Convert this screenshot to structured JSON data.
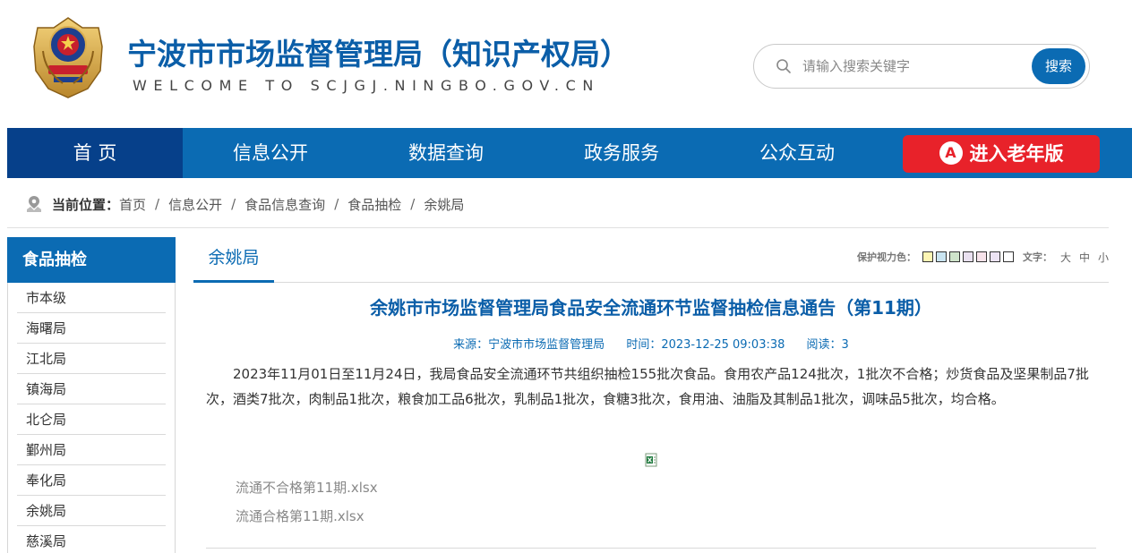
{
  "header": {
    "title": "宁波市市场监督管理局（知识产权局）",
    "subtitle": "WELCOME TO SCJGJ.NINGBO.GOV.CN",
    "search_placeholder": "请输入搜索关键字",
    "search_button": "搜索"
  },
  "nav": {
    "items": [
      "首 页",
      "信息公开",
      "数据查询",
      "政务服务",
      "公众互动"
    ],
    "active_index": 0,
    "elder_button": "进入老年版",
    "elder_icon_glyph": "A"
  },
  "breadcrumb": {
    "label": "当前位置：",
    "items": [
      "首页",
      "信息公开",
      "食品信息查询",
      "食品抽检",
      "余姚局"
    ],
    "separator": "/"
  },
  "sidebar": {
    "heading": "食品抽检",
    "items": [
      "市本级",
      "海曙局",
      "江北局",
      "镇海局",
      "北仑局",
      "鄞州局",
      "奉化局",
      "余姚局",
      "慈溪局"
    ]
  },
  "content": {
    "tab": "余姚局",
    "tools": {
      "eye_label": "保护视力色：",
      "swatch_colors": [
        "#fdf5b4",
        "#c9e4f1",
        "#cfe4cb",
        "#eae1f0",
        "#f7e3ea",
        "#ede3f4",
        "#ffffff"
      ],
      "size_label": "文字：",
      "sizes": [
        "大",
        "中",
        "小"
      ]
    },
    "title": "余姚市市场监督管理局食品安全流通环节监督抽检信息通告（第11期）",
    "meta": {
      "source": "来源：宁波市市场监督管理局",
      "time": "时间：2023-12-25 09:03:38",
      "reads": "阅读：3"
    },
    "body": "2023年11月01日至11月24日，我局食品安全流通环节共组织抽检155批次食品。食用农产品124批次，1批次不合格；炒货食品及坚果制品7批次，酒类7批次，肉制品1批次，粮食加工品6批次，乳制品1批次，食糖3批次，食用油、油脂及其制品1批次，调味品5批次，均合格。",
    "attachments": [
      "流通不合格第11期.xlsx",
      "流通合格第11期.xlsx"
    ]
  },
  "colors": {
    "brand_blue": "#0b6bb3",
    "nav_active": "#06408a",
    "elder_red": "#e8222a"
  }
}
